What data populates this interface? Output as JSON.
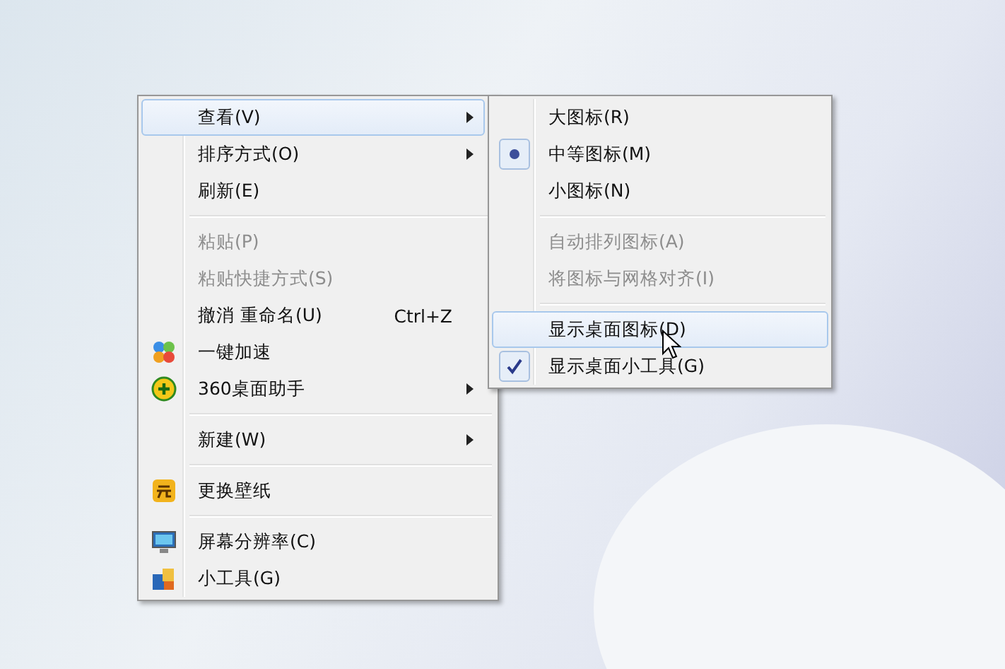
{
  "context_menu": {
    "items": [
      {
        "kind": "item",
        "label": "查看(V)",
        "submenu": true,
        "disabled": false,
        "highlighted": true
      },
      {
        "kind": "item",
        "label": "排序方式(O)",
        "submenu": true,
        "disabled": false,
        "highlighted": false
      },
      {
        "kind": "item",
        "label": "刷新(E)",
        "submenu": false,
        "disabled": false,
        "highlighted": false
      },
      {
        "kind": "separator"
      },
      {
        "kind": "item",
        "label": "粘贴(P)",
        "submenu": false,
        "disabled": true,
        "highlighted": false
      },
      {
        "kind": "item",
        "label": "粘贴快捷方式(S)",
        "submenu": false,
        "disabled": true,
        "highlighted": false
      },
      {
        "kind": "item",
        "label": "撤消 重命名(U)",
        "shortcut": "Ctrl+Z",
        "submenu": false,
        "disabled": false,
        "highlighted": false
      },
      {
        "kind": "app",
        "label": "一键加速",
        "submenu": false,
        "disabled": false,
        "highlighted": false
      },
      {
        "kind": "app",
        "label": "360桌面助手",
        "submenu": true,
        "disabled": false,
        "highlighted": false
      },
      {
        "kind": "separator"
      },
      {
        "kind": "item",
        "label": "新建(W)",
        "submenu": true,
        "disabled": false,
        "highlighted": false
      },
      {
        "kind": "separator"
      },
      {
        "kind": "app",
        "label": "更换壁纸",
        "submenu": false,
        "disabled": false,
        "highlighted": false
      },
      {
        "kind": "separator"
      },
      {
        "kind": "app",
        "label": "屏幕分辨率(C)",
        "submenu": false,
        "disabled": false,
        "highlighted": false
      },
      {
        "kind": "app",
        "label": "小工具(G)",
        "submenu": false,
        "disabled": false,
        "highlighted": false
      }
    ]
  },
  "view_submenu": {
    "items": [
      {
        "kind": "radio",
        "label": "大图标(R)",
        "selected": false,
        "disabled": false,
        "highlighted": false
      },
      {
        "kind": "radio",
        "label": "中等图标(M)",
        "selected": true,
        "disabled": false,
        "highlighted": false
      },
      {
        "kind": "radio",
        "label": "小图标(N)",
        "selected": false,
        "disabled": false,
        "highlighted": false
      },
      {
        "kind": "separator"
      },
      {
        "kind": "check",
        "label": "自动排列图标(A)",
        "checked": false,
        "disabled": true,
        "highlighted": false
      },
      {
        "kind": "check",
        "label": "将图标与网格对齐(I)",
        "checked": false,
        "disabled": true,
        "highlighted": false
      },
      {
        "kind": "separator"
      },
      {
        "kind": "check",
        "label": "显示桌面图标(D)",
        "checked": false,
        "disabled": false,
        "highlighted": true
      },
      {
        "kind": "check",
        "label": "显示桌面小工具(G)",
        "checked": true,
        "disabled": false,
        "highlighted": false
      }
    ]
  }
}
